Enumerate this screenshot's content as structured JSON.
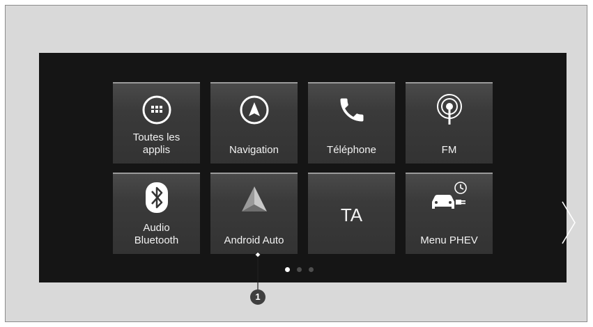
{
  "tiles": [
    {
      "label": "Toutes les applis",
      "icon": "apps-grid-icon"
    },
    {
      "label": "Navigation",
      "icon": "navigation-compass-icon"
    },
    {
      "label": "Téléphone",
      "icon": "phone-icon"
    },
    {
      "label": "FM",
      "icon": "radio-antenna-icon"
    },
    {
      "label": "Audio Bluetooth",
      "icon": "bluetooth-icon"
    },
    {
      "label": "Android Auto",
      "icon": "android-auto-icon"
    },
    {
      "label": "TA",
      "icon": ""
    },
    {
      "label": "Menu PHEV",
      "icon": "phev-car-plug-icon"
    }
  ],
  "pagination": {
    "current": 1,
    "total": 3
  },
  "next_icon": "chevron-right-icon",
  "callout": {
    "number": "1"
  },
  "colors": {
    "screen_bg": "#151515",
    "tile_bg": "#3a3a3a",
    "frame_bg": "#d9d9d9",
    "text": "#ffffff"
  }
}
